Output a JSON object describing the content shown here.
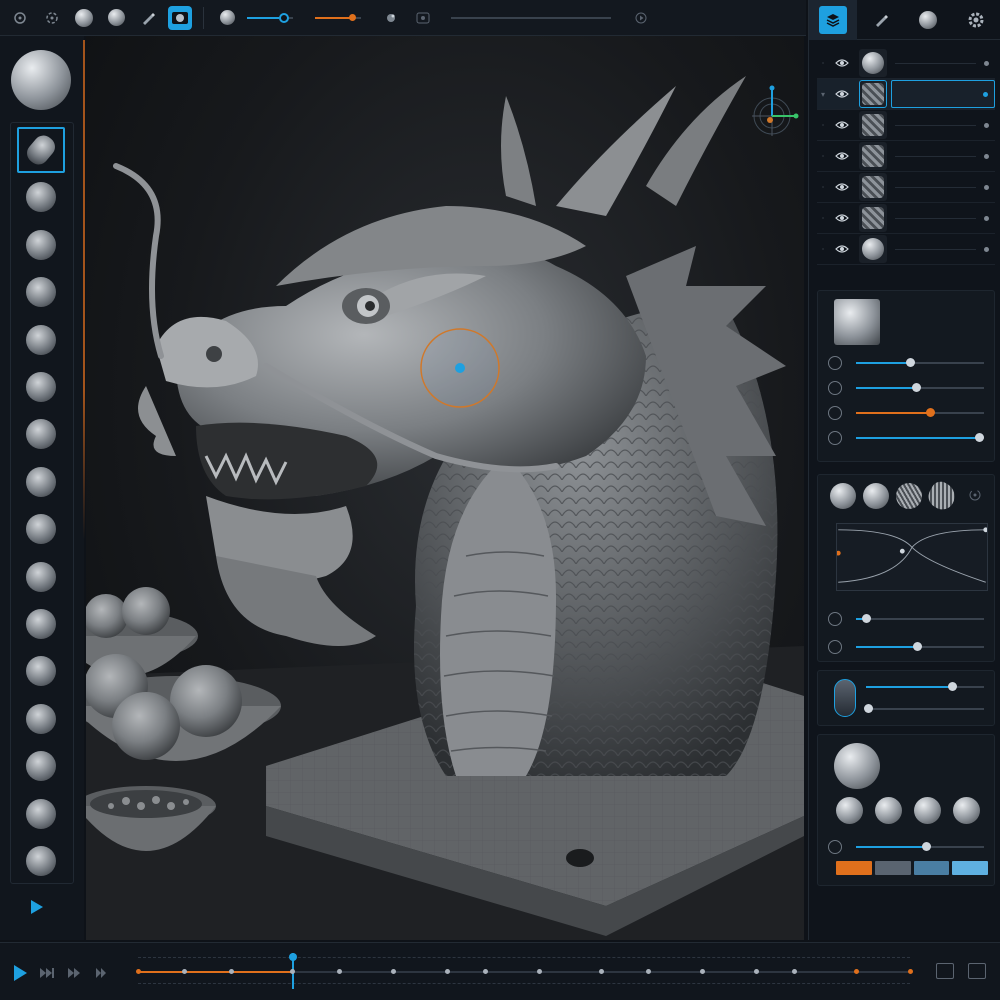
{
  "theme": {
    "accent": "#1ea0e0",
    "accent_orange": "#e0701c",
    "background": "#0e1218"
  },
  "top_toolbar": {
    "tools": [
      "undo-icon",
      "redo-icon",
      "sphere-material-icon",
      "matcap-icon",
      "brush-icon",
      "camera-view-icon"
    ],
    "active_tool": "camera-view-icon",
    "sliders": [
      {
        "name": "brush-size",
        "value": 0.82,
        "color": "#1ea0e0"
      },
      {
        "name": "brush-intensity",
        "value": 0.78,
        "color": "#e0701c"
      }
    ],
    "extra_icons": [
      "symmetry-icon",
      "history-icon"
    ]
  },
  "left_toolbar": {
    "material_preview": "sphere-icon",
    "tools": [
      "clay-buildup-brush-icon",
      "move-brush-icon",
      "inflate-brush-icon",
      "standard-brush-icon",
      "dam-standard-brush-icon",
      "claytubes-brush-icon",
      "trim-brush-icon",
      "pinch-brush-icon",
      "snake-hook-brush-icon",
      "layer-brush-icon",
      "smooth-brush-icon",
      "mask-brush-icon",
      "polish-brush-icon",
      "curve-brush-icon",
      "slash-brush-icon",
      "crease-brush-icon"
    ],
    "active_tool_index": 0,
    "play_icon": "play-icon"
  },
  "right_panel": {
    "tabs": [
      "layers-tab-icon",
      "brush-tab-icon",
      "material-tab-icon",
      "settings-tab-icon"
    ],
    "active_tab": 0,
    "layers": [
      {
        "visible": true,
        "thumb": "sphere",
        "selected": false
      },
      {
        "visible": true,
        "thumb": "dragon",
        "selected": true
      },
      {
        "visible": true,
        "thumb": "horns",
        "selected": false
      },
      {
        "visible": true,
        "thumb": "scales",
        "selected": false
      },
      {
        "visible": true,
        "thumb": "texture",
        "selected": false
      },
      {
        "visible": true,
        "thumb": "mesh",
        "selected": false
      },
      {
        "visible": true,
        "thumb": "sphere",
        "selected": false
      }
    ],
    "brush_sliders": [
      {
        "name": "radius",
        "value": 0.42,
        "color": "#1ea0e0"
      },
      {
        "name": "strength",
        "value": 0.47,
        "color": "#1ea0e0"
      },
      {
        "name": "hardness",
        "value": 0.58,
        "color": "#e0701c"
      },
      {
        "name": "spacing",
        "value": 0.96,
        "color": "#1ea0e0"
      }
    ],
    "alpha_presets": [
      "round-alpha-icon",
      "soft-alpha-icon",
      "pattern-alpha-icon",
      "noise-alpha-icon"
    ],
    "falloff_sliders": [
      {
        "name": "falloff-start",
        "value": 0.08,
        "color": "#1ea0e0"
      },
      {
        "name": "falloff-end",
        "value": 0.48,
        "color": "#1ea0e0"
      }
    ],
    "pen_sliders": [
      {
        "name": "pressure-size",
        "value": 0.73,
        "color": "#1ea0e0"
      },
      {
        "name": "pressure-opacity",
        "value": 0.02,
        "color": "#1ea0e0"
      }
    ],
    "matcap_presets": [
      "matcap-1-icon",
      "matcap-2-icon",
      "matcap-3-icon",
      "matcap-4-icon"
    ],
    "material_slider": {
      "value": 0.55,
      "color": "#1ea0e0"
    },
    "palette": [
      "#e0701c",
      "#5a6470",
      "#4a7ea3",
      "#5fb0e0"
    ]
  },
  "timeline": {
    "controls": [
      "play-icon",
      "next-frame-icon",
      "next-key-icon",
      "end-icon"
    ],
    "playhead": 0.2,
    "keyframes": [
      0.0,
      0.06,
      0.12,
      0.2,
      0.26,
      0.33,
      0.4,
      0.45,
      0.52,
      0.6,
      0.66,
      0.73,
      0.8,
      0.85,
      0.93,
      1.0
    ],
    "right_buttons": [
      "frame-counter-icon",
      "fullscreen-icon"
    ]
  }
}
